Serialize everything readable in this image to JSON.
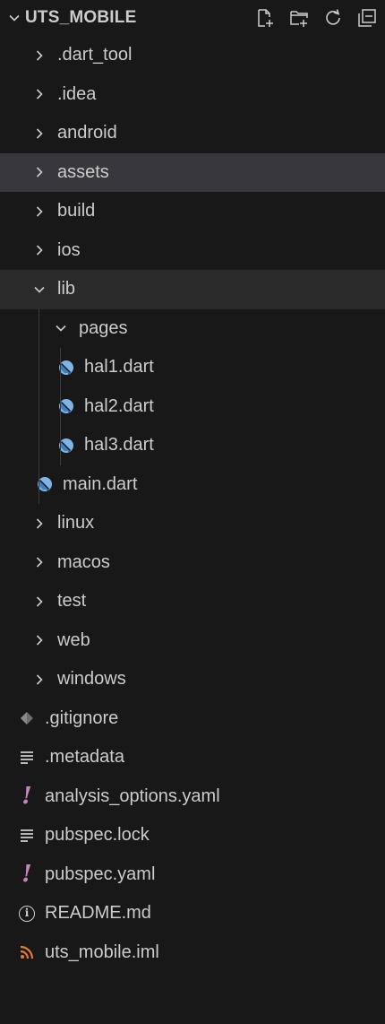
{
  "explorer": {
    "project_title": "UTS_MOBILE",
    "actions": [
      {
        "name": "new-file-icon"
      },
      {
        "name": "new-folder-icon"
      },
      {
        "name": "refresh-icon"
      },
      {
        "name": "collapse-all-icon"
      }
    ]
  },
  "tree": {
    "items": [
      {
        "label": ".dart_tool",
        "type": "folder",
        "level": 0,
        "expanded": false
      },
      {
        "label": ".idea",
        "type": "folder",
        "level": 0,
        "expanded": false
      },
      {
        "label": "android",
        "type": "folder",
        "level": 0,
        "expanded": false
      },
      {
        "label": "assets",
        "type": "folder",
        "level": 0,
        "expanded": false
      },
      {
        "label": "build",
        "type": "folder",
        "level": 0,
        "expanded": false
      },
      {
        "label": "ios",
        "type": "folder",
        "level": 0,
        "expanded": false
      },
      {
        "label": "lib",
        "type": "folder",
        "level": 0,
        "expanded": true
      },
      {
        "label": "pages",
        "type": "folder",
        "level": 1,
        "expanded": true
      },
      {
        "label": "hal1.dart",
        "type": "dart",
        "level": 2
      },
      {
        "label": "hal2.dart",
        "type": "dart",
        "level": 2
      },
      {
        "label": "hal3.dart",
        "type": "dart",
        "level": 2
      },
      {
        "label": "main.dart",
        "type": "dart",
        "level": 1
      },
      {
        "label": "linux",
        "type": "folder",
        "level": 0,
        "expanded": false
      },
      {
        "label": "macos",
        "type": "folder",
        "level": 0,
        "expanded": false
      },
      {
        "label": "test",
        "type": "folder",
        "level": 0,
        "expanded": false
      },
      {
        "label": "web",
        "type": "folder",
        "level": 0,
        "expanded": false
      },
      {
        "label": "windows",
        "type": "folder",
        "level": 0,
        "expanded": false
      },
      {
        "label": ".gitignore",
        "type": "gitignore",
        "level": 0
      },
      {
        "label": ".metadata",
        "type": "text",
        "level": 0
      },
      {
        "label": "analysis_options.yaml",
        "type": "yaml",
        "level": 0
      },
      {
        "label": "pubspec.lock",
        "type": "text",
        "level": 0
      },
      {
        "label": "pubspec.yaml",
        "type": "yaml",
        "level": 0
      },
      {
        "label": "README.md",
        "type": "info",
        "level": 0
      },
      {
        "label": "uts_mobile.iml",
        "type": "rss",
        "level": 0
      }
    ]
  },
  "colors": {
    "background": "#181818",
    "hover_row": "#2a2a2b",
    "selected_row": "#37373d",
    "text": "#cccccc",
    "dart_icon": "#7fb5e6",
    "yaml_icon": "#c586c0",
    "rss_icon": "#e37933",
    "gitignore_icon": "#6d6d6d"
  }
}
